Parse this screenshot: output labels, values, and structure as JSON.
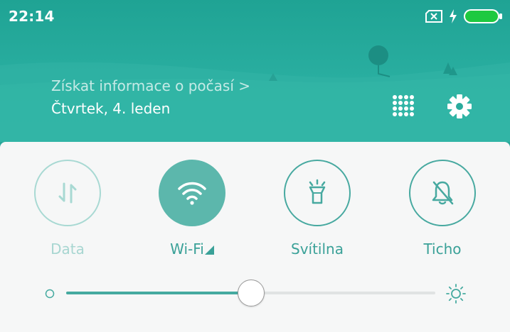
{
  "status_bar": {
    "time": "22:14",
    "icons": [
      "no-sim-icon",
      "charging-bolt-icon",
      "battery-icon"
    ],
    "battery_level": 1.0,
    "battery_color": "#1ec940"
  },
  "header": {
    "weather_link": "Získat informace o počasí >",
    "date": "Čtvrtek, 4. leden",
    "icons": [
      "app-grid-icon",
      "settings-gear-icon"
    ]
  },
  "quick_tiles": [
    {
      "label": "Data",
      "icon": "mobile-data-arrows-icon",
      "state": "disabled"
    },
    {
      "label": "Wi-Fi",
      "icon": "wifi-icon",
      "state": "on"
    },
    {
      "label": "Svítilna",
      "icon": "flashlight-icon",
      "state": "off"
    },
    {
      "label": "Ticho",
      "icon": "bell-muted-icon",
      "state": "off"
    }
  ],
  "brightness": {
    "level": 0.5,
    "icons": [
      "brightness-low-icon",
      "brightness-high-icon"
    ]
  },
  "colors": {
    "header": "#29aea0",
    "accent": "#47a9a0",
    "active_tile": "#5cb7ac",
    "panel": "#f6f7f7"
  }
}
